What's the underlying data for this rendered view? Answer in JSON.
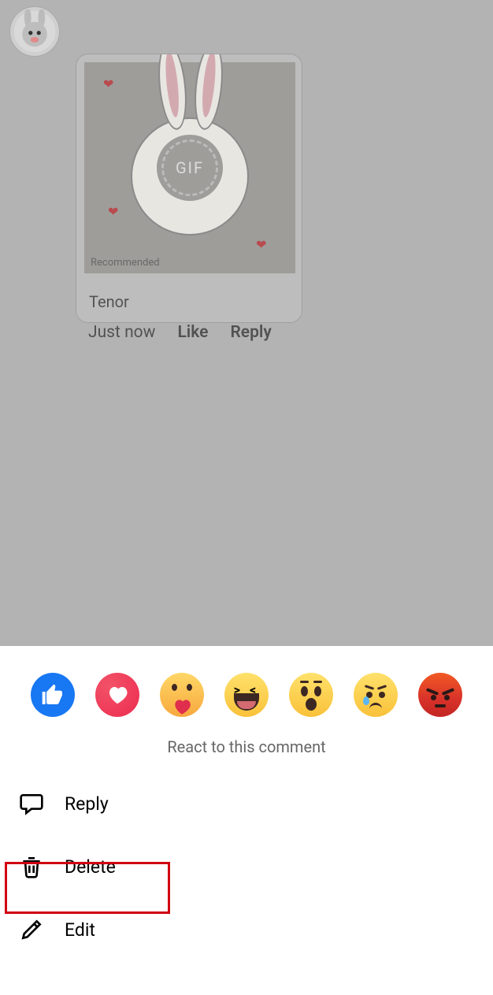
{
  "comment": {
    "attachment": {
      "source_label": "Tenor",
      "gif_badge": "GIF",
      "recommended_label": "Recommended"
    },
    "timestamp": "Just now",
    "like_action": "Like",
    "reply_action": "Reply"
  },
  "action_sheet": {
    "react_label": "React to this comment",
    "reactions": [
      {
        "name": "like"
      },
      {
        "name": "love"
      },
      {
        "name": "care"
      },
      {
        "name": "haha"
      },
      {
        "name": "wow"
      },
      {
        "name": "sad"
      },
      {
        "name": "angry"
      }
    ],
    "options": {
      "reply": "Reply",
      "delete": "Delete",
      "edit": "Edit"
    }
  },
  "highlight": {
    "target": "delete"
  }
}
